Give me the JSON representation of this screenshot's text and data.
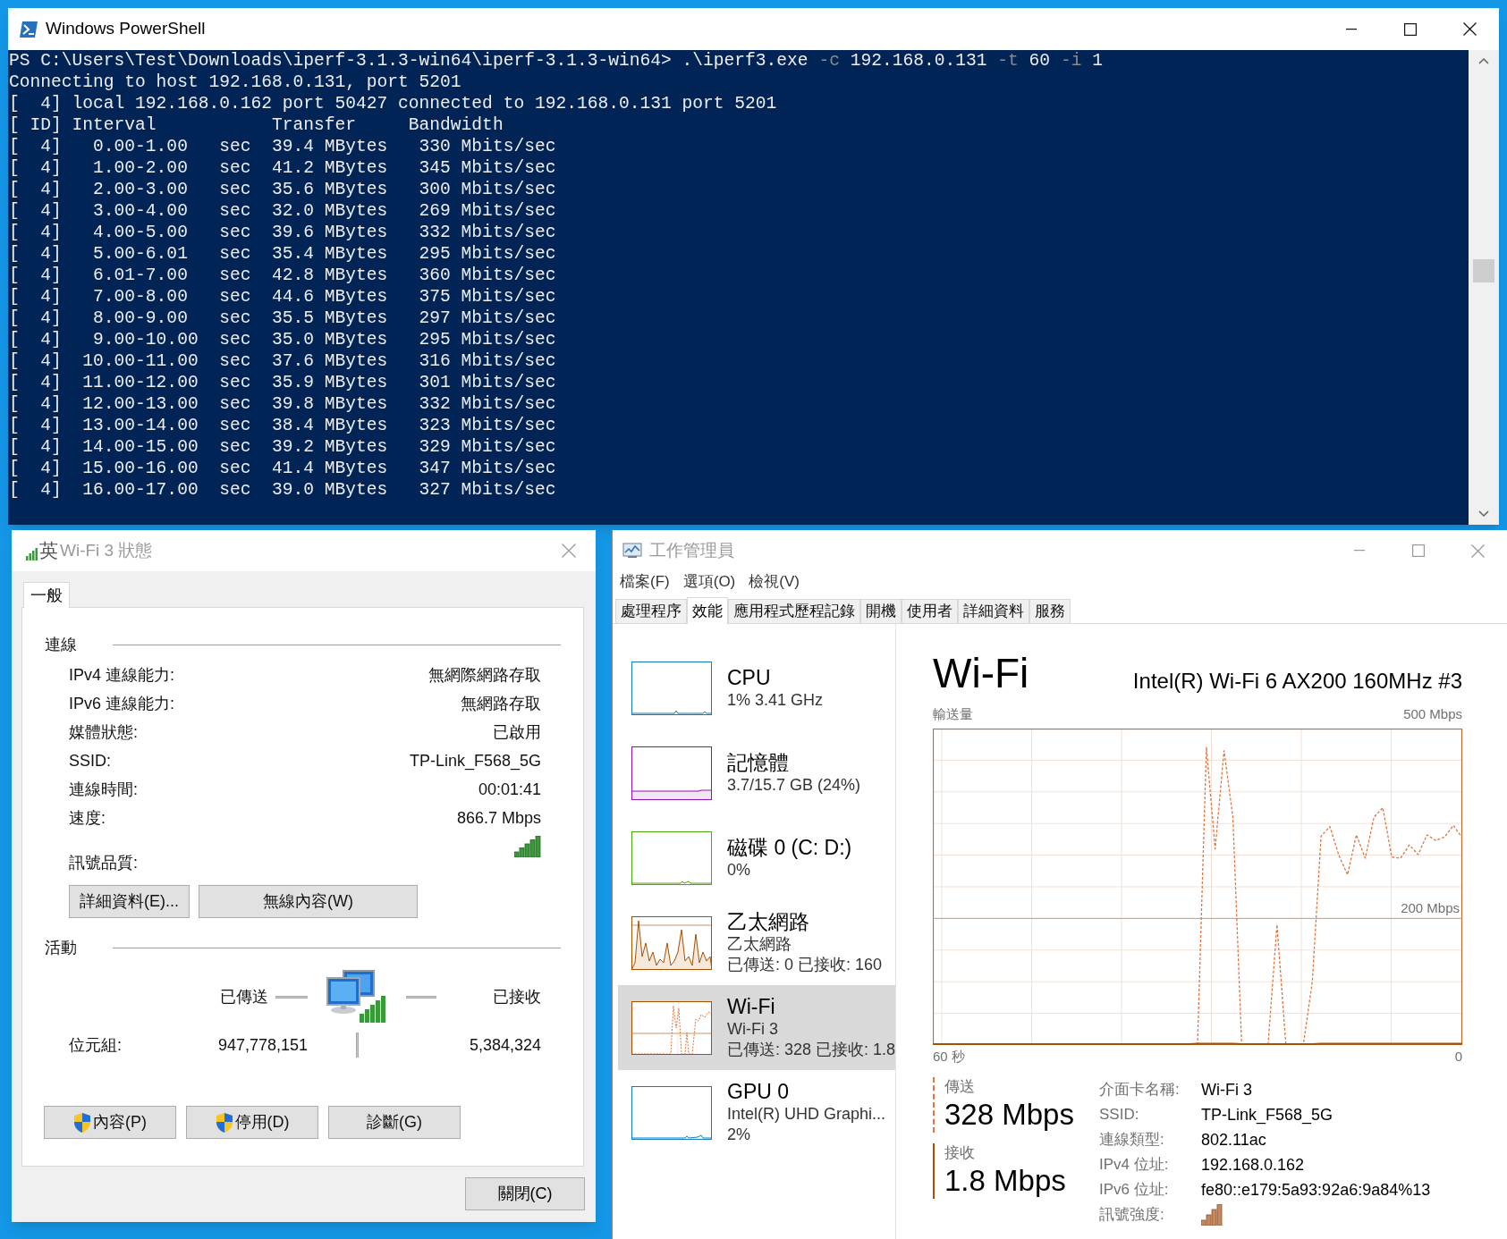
{
  "powershell": {
    "title": "Windows PowerShell",
    "command": [
      {
        "kind": "text",
        "text": "PS C:\\Users\\Test\\Downloads\\iperf-3.1.3-win64\\iperf-3.1.3-win64> .\\iperf3.exe "
      },
      {
        "kind": "param",
        "text": "-c"
      },
      {
        "kind": "text",
        "text": " 192.168.0.131 "
      },
      {
        "kind": "param",
        "text": "-t"
      },
      {
        "kind": "text",
        "text": " 60 "
      },
      {
        "kind": "param",
        "text": "-i"
      },
      {
        "kind": "text",
        "text": " 1"
      }
    ],
    "output": [
      "Connecting to host 192.168.0.131, port 5201",
      "[  4] local 192.168.0.162 port 50427 connected to 192.168.0.131 port 5201",
      "[ ID] Interval           Transfer     Bandwidth",
      "[  4]   0.00-1.00   sec  39.4 MBytes   330 Mbits/sec",
      "[  4]   1.00-2.00   sec  41.2 MBytes   345 Mbits/sec",
      "[  4]   2.00-3.00   sec  35.6 MBytes   300 Mbits/sec",
      "[  4]   3.00-4.00   sec  32.0 MBytes   269 Mbits/sec",
      "[  4]   4.00-5.00   sec  39.6 MBytes   332 Mbits/sec",
      "[  4]   5.00-6.01   sec  35.4 MBytes   295 Mbits/sec",
      "[  4]   6.01-7.00   sec  42.8 MBytes   360 Mbits/sec",
      "[  4]   7.00-8.00   sec  44.6 MBytes   375 Mbits/sec",
      "[  4]   8.00-9.00   sec  35.5 MBytes   297 Mbits/sec",
      "[  4]   9.00-10.00  sec  35.0 MBytes   295 Mbits/sec",
      "[  4]  10.00-11.00  sec  37.6 MBytes   316 Mbits/sec",
      "[  4]  11.00-12.00  sec  35.9 MBytes   301 Mbits/sec",
      "[  4]  12.00-13.00  sec  39.8 MBytes   332 Mbits/sec",
      "[  4]  13.00-14.00  sec  38.4 MBytes   323 Mbits/sec",
      "[  4]  14.00-15.00  sec  39.2 MBytes   329 Mbits/sec",
      "[  4]  15.00-16.00  sec  41.4 MBytes   347 Mbits/sec",
      "[  4]  16.00-17.00  sec  39.0 MBytes   327 Mbits/sec"
    ]
  },
  "wifi_status": {
    "title": "Wi-Fi 3 狀態",
    "ime_indicator": "英",
    "tabs": [
      {
        "label": "一般",
        "selected": true
      }
    ],
    "connection_heading": "連線",
    "fields": [
      {
        "kind": "text",
        "label": "IPv4 連線能力:",
        "value": "無網際網路存取"
      },
      {
        "kind": "text",
        "label": "IPv6 連線能力:",
        "value": "無網路存取"
      },
      {
        "kind": "text",
        "label": "媒體狀態:",
        "value": "已啟用"
      },
      {
        "kind": "text",
        "label": "SSID:",
        "value": "TP-Link_F568_5G"
      },
      {
        "kind": "text",
        "label": "連線時間:",
        "value": "00:01:41"
      },
      {
        "kind": "text",
        "label": "速度:",
        "value": "866.7 Mbps"
      },
      {
        "kind": "signal",
        "label": "訊號品質:"
      }
    ],
    "buttons": [
      "詳細資料(E)...",
      "無線內容(W)"
    ],
    "activity_heading": "活動",
    "sent_label": "已傳送",
    "received_label": "已接收",
    "bytes_label": "位元組:",
    "bytes_sent": "947,778,151",
    "bytes_received": "5,384,324",
    "action_buttons": [
      {
        "label": "內容(P)",
        "shield": true
      },
      {
        "label": "停用(D)",
        "shield": true
      },
      {
        "label": "診斷(G)",
        "shield": false
      }
    ],
    "close_button": "關閉(C)"
  },
  "task_manager": {
    "title": "工作管理員",
    "menu": [
      "檔案(F)",
      "選項(O)",
      "檢視(V)"
    ],
    "tabs": [
      {
        "label": "處理程序",
        "selected": false
      },
      {
        "label": "效能",
        "selected": true
      },
      {
        "label": "應用程式歷程記錄",
        "selected": false
      },
      {
        "label": "開機",
        "selected": false
      },
      {
        "label": "使用者",
        "selected": false
      },
      {
        "label": "詳細資料",
        "selected": false
      },
      {
        "label": "服務",
        "selected": false
      }
    ],
    "resources": [
      {
        "kind": "cpu",
        "name": "CPU",
        "lines": [
          "1%  3.41 GHz"
        ],
        "color": "#117dbb",
        "selected": false
      },
      {
        "kind": "memory",
        "name": "記憶體",
        "lines": [
          "3.7/15.7 GB (24%)"
        ],
        "color": "#8b12ae",
        "selected": false
      },
      {
        "kind": "disk",
        "name": "磁碟 0 (C: D:)",
        "lines": [
          "0%"
        ],
        "color": "#4da60c",
        "selected": false
      },
      {
        "kind": "ethernet",
        "name": "乙太網路",
        "lines": [
          "乙太網路",
          "已傳送: 0 已接收: 160"
        ],
        "color": "#a74f01",
        "selected": false
      },
      {
        "kind": "wifi",
        "name": "Wi-Fi",
        "lines": [
          "Wi-Fi 3",
          "已傳送: 328 已接收: 1.8"
        ],
        "color": "#a74f01",
        "selected": true
      },
      {
        "kind": "gpu",
        "name": "GPU 0",
        "lines": [
          "Intel(R) UHD Graphi...",
          "2%"
        ],
        "color": "#117dbb",
        "selected": false
      }
    ],
    "detail": {
      "title": "Wi-Fi",
      "adapter": "Intel(R) Wi-Fi 6 AX200 160MHz #3",
      "graph": {
        "title": "輸送量",
        "scale_max": "500 Mbps",
        "scale_mark": "200 Mbps",
        "time_start": "60 秒",
        "time_end": "0"
      },
      "stats": [
        {
          "kind": "send",
          "label": "傳送",
          "value": "328 Mbps"
        },
        {
          "kind": "receive",
          "label": "接收",
          "value": "1.8 Mbps"
        }
      ],
      "properties": [
        {
          "kind": "text",
          "label": "介面卡名稱:",
          "value": "Wi-Fi 3"
        },
        {
          "kind": "text",
          "label": "SSID:",
          "value": "TP-Link_F568_5G"
        },
        {
          "kind": "text",
          "label": "連線類型:",
          "value": "802.11ac"
        },
        {
          "kind": "text",
          "label": "IPv4 位址:",
          "value": "192.168.0.162"
        },
        {
          "kind": "text",
          "label": "IPv6 位址:",
          "value": "fe80::e179:5a93:92a6:9a84%13"
        },
        {
          "kind": "signal",
          "label": "訊號強度:"
        }
      ]
    }
  }
}
